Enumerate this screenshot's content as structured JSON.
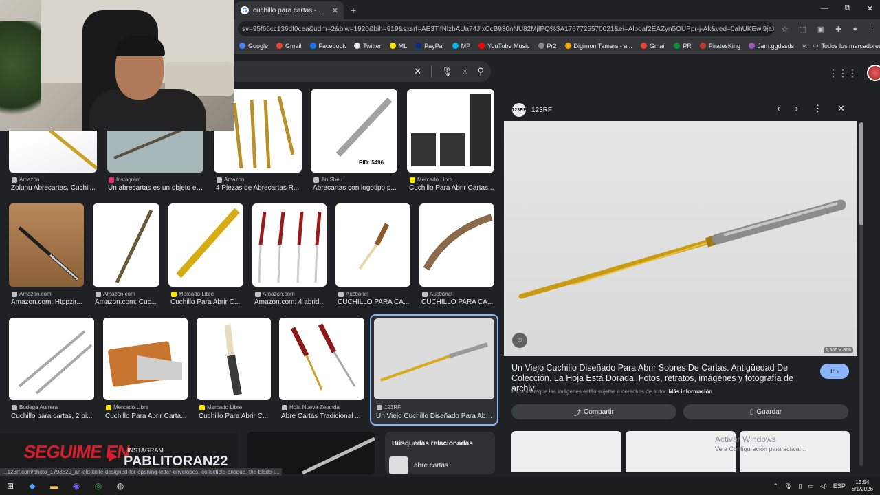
{
  "webcam": {},
  "tabs": [
    {
      "title": "cuchillo para cartas - Buscar co",
      "favicon": "G"
    }
  ],
  "window_controls": {
    "minimize": "—",
    "restore": "⧉",
    "close": "✕"
  },
  "address": {
    "url": "sv=95f66cc136df0cea&udm=2&biw=1920&bih=919&sxsrf=AE3TifNlzbAUa74JlxCcB930nNU82MjIPQ%3A1767725570021&ei=Alpdaf2EAZyn5OUPpr-j-Ak&ved=0ahUKEwj9jaX1yveRA"
  },
  "bookmarks": [
    {
      "label": "Google",
      "color": "#4285f4"
    },
    {
      "label": "Gmail",
      "color": "#ea4335"
    },
    {
      "label": "Facebook",
      "color": "#1877f2"
    },
    {
      "label": "Twitter",
      "color": "#e8eaed"
    },
    {
      "label": "ML",
      "color": "#ffe600"
    },
    {
      "label": "PayPal",
      "color": "#003087"
    },
    {
      "label": "MP",
      "color": "#00b1ea"
    },
    {
      "label": "YouTube Music",
      "color": "#ff0000"
    },
    {
      "label": "Pr2",
      "color": "#888888"
    },
    {
      "label": "Digimon Tamers - a...",
      "color": "#f4a100"
    },
    {
      "label": "Gmail",
      "color": "#ea4335"
    },
    {
      "label": "PR",
      "color": "#0a8f3c"
    },
    {
      "label": "PiratesKing",
      "color": "#c0392b"
    },
    {
      "label": "Jam.ggdssds",
      "color": "#9b59b6"
    }
  ],
  "bookmarks_folder": "Todos los marcadores",
  "grid": {
    "row0": [
      {
        "source": "Amazon",
        "caption": "Zolunu Abrecartas, Cuchil..."
      },
      {
        "source": "Instagram",
        "caption": "Un abrecartas es un objeto en..."
      },
      {
        "source": "Amazon",
        "caption": "4 Piezas de Abrecartas R..."
      },
      {
        "source": "Jin Sheu",
        "caption": "Abrecartas con logotipo p...",
        "overlay": "PID: 5496"
      },
      {
        "source": "Mercado Libre",
        "caption": "Cuchillo Para Abrir Cartas..."
      }
    ],
    "row1": [
      {
        "source": "Amazon.com",
        "caption": "Amazon.com: Htppzjr..."
      },
      {
        "source": "Amazon.com",
        "caption": "Amazon.com: Cuc..."
      },
      {
        "source": "Mercado Libre",
        "caption": "Cuchillo Para Abrir C..."
      },
      {
        "source": "Amazon.com",
        "caption": "Amazon.com: 4 abrid..."
      },
      {
        "source": "Auctionet",
        "caption": "CUCHILLO PARA CA..."
      },
      {
        "source": "Auctionet",
        "caption": "CUCHILLO PARA CA..."
      }
    ],
    "row2": [
      {
        "source": "Bodega Aurrera",
        "caption": "Cuchillo para cartas, 2 pi..."
      },
      {
        "source": "Mercado Libre",
        "caption": "Cuchillo Para Abrir Carta..."
      },
      {
        "source": "Mercado Libre",
        "caption": "Cuchillo Para Abrir C..."
      },
      {
        "source": "Hola Nueva Zelanda",
        "caption": "Abre Cartas Tradicional ..."
      },
      {
        "source": "123RF",
        "caption": "Un Viejo Cuchillo Diseñado Para Abri..."
      }
    ]
  },
  "banner": {
    "follow": "SEGUIME EN",
    "platform": "INSTAGRAM",
    "handle": "PABLITORAN22"
  },
  "related": {
    "heading": "Búsquedas relacionadas",
    "item": "abre cartas"
  },
  "panel": {
    "source": "123RF",
    "source_logo": "123RF",
    "dims": "1,300 × 866",
    "title": "Un Viejo Cuchillo Diseñado Para Abrir Sobres De Cartas. Antigüedad De Colección. La Hoja Está Dorada. Fotos, retratos, imágenes y fotografía de archiv...",
    "go_label": "Ir",
    "note": "Es posible que las imágenes estén sujetas a derechos de autor.",
    "more_info": "Más información",
    "share_label": "Compartir",
    "save_label": "Guardar"
  },
  "windows_watermark": {
    "line1": "Activar Windows",
    "line2": "Ve a Configuración para activar..."
  },
  "status_url": "...123rf.com/photo_1793829_an-old-knife-designed-for-opening-letter-envelopes.-collectible-antique.-the-blade-i...",
  "taskbar": {
    "lang": "ESP",
    "time": "15:54",
    "date": "6/1/2026"
  }
}
